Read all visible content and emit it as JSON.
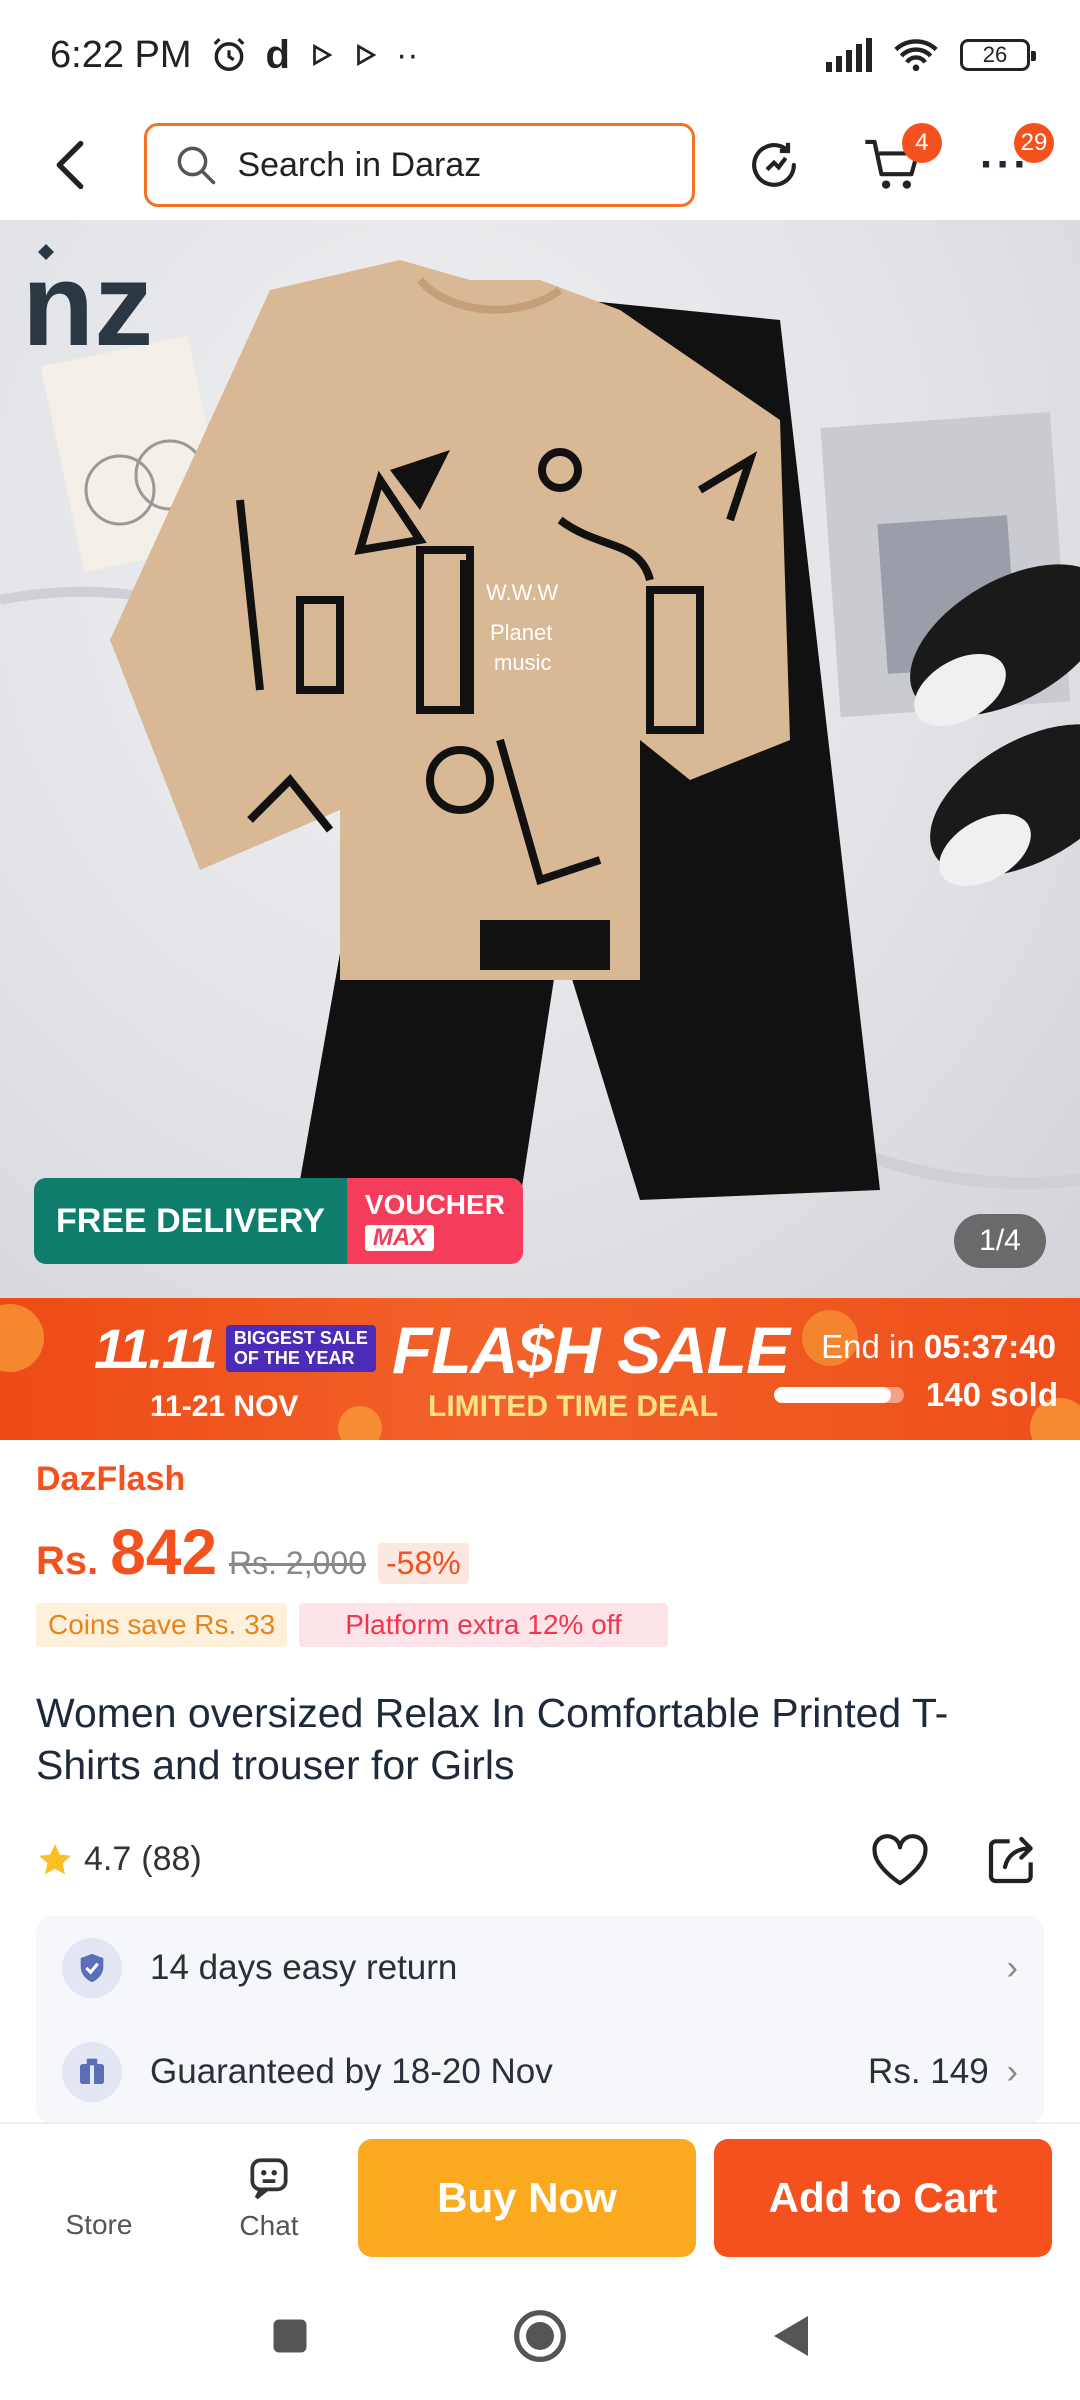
{
  "status_bar": {
    "time": "6:22 PM",
    "app_icons": [
      "alarm-icon",
      "d-icon",
      "play-icon",
      "play-icon",
      "more-dots-icon"
    ],
    "battery": "26"
  },
  "top_nav": {
    "search_placeholder": "Search in Daraz",
    "cart_badge": "4",
    "more_badge": "29"
  },
  "gallery": {
    "free_delivery": "FREE DELIVERY",
    "voucher": "VOUCHER",
    "voucher_max": "MAX",
    "counter": "1/4",
    "brand_logo_text": "nz"
  },
  "flash_sale": {
    "event": "11.11",
    "event_sub_line1": "BIGGEST SALE",
    "event_sub_line2": "OF THE YEAR",
    "event_dates": "11-21 NOV",
    "title": "FLA$H SALE",
    "subtitle": "LIMITED TIME DEAL",
    "end_label": "End in",
    "end_time": "05:37:40",
    "sold": "140 sold",
    "sold_progress": 0.9
  },
  "product": {
    "campaign": "DazFlash",
    "currency": "Rs.",
    "price": "842",
    "old_price": "Rs. 2,000",
    "discount": "-58%",
    "coins_save": "Coins save Rs. 33",
    "platform_extra": "Platform extra 12% off",
    "title": "Women oversized Relax In Comfortable Printed T-Shirts and trouser for Girls",
    "rating": "4.7",
    "rating_count": "(88)"
  },
  "services": [
    {
      "label": "14 days easy return",
      "value": ""
    },
    {
      "label": "Guaranteed by 18-20 Nov",
      "value": "Rs. 149"
    }
  ],
  "bottom_bar": {
    "store": "Store",
    "chat": "Chat",
    "buy_now": "Buy Now",
    "add_to_cart": "Add to Cart"
  },
  "colors": {
    "accent": "#f4511e",
    "buy_now": "#fbaa1f",
    "free_delivery": "#0e7d6b",
    "voucher": "#f33d5b"
  }
}
